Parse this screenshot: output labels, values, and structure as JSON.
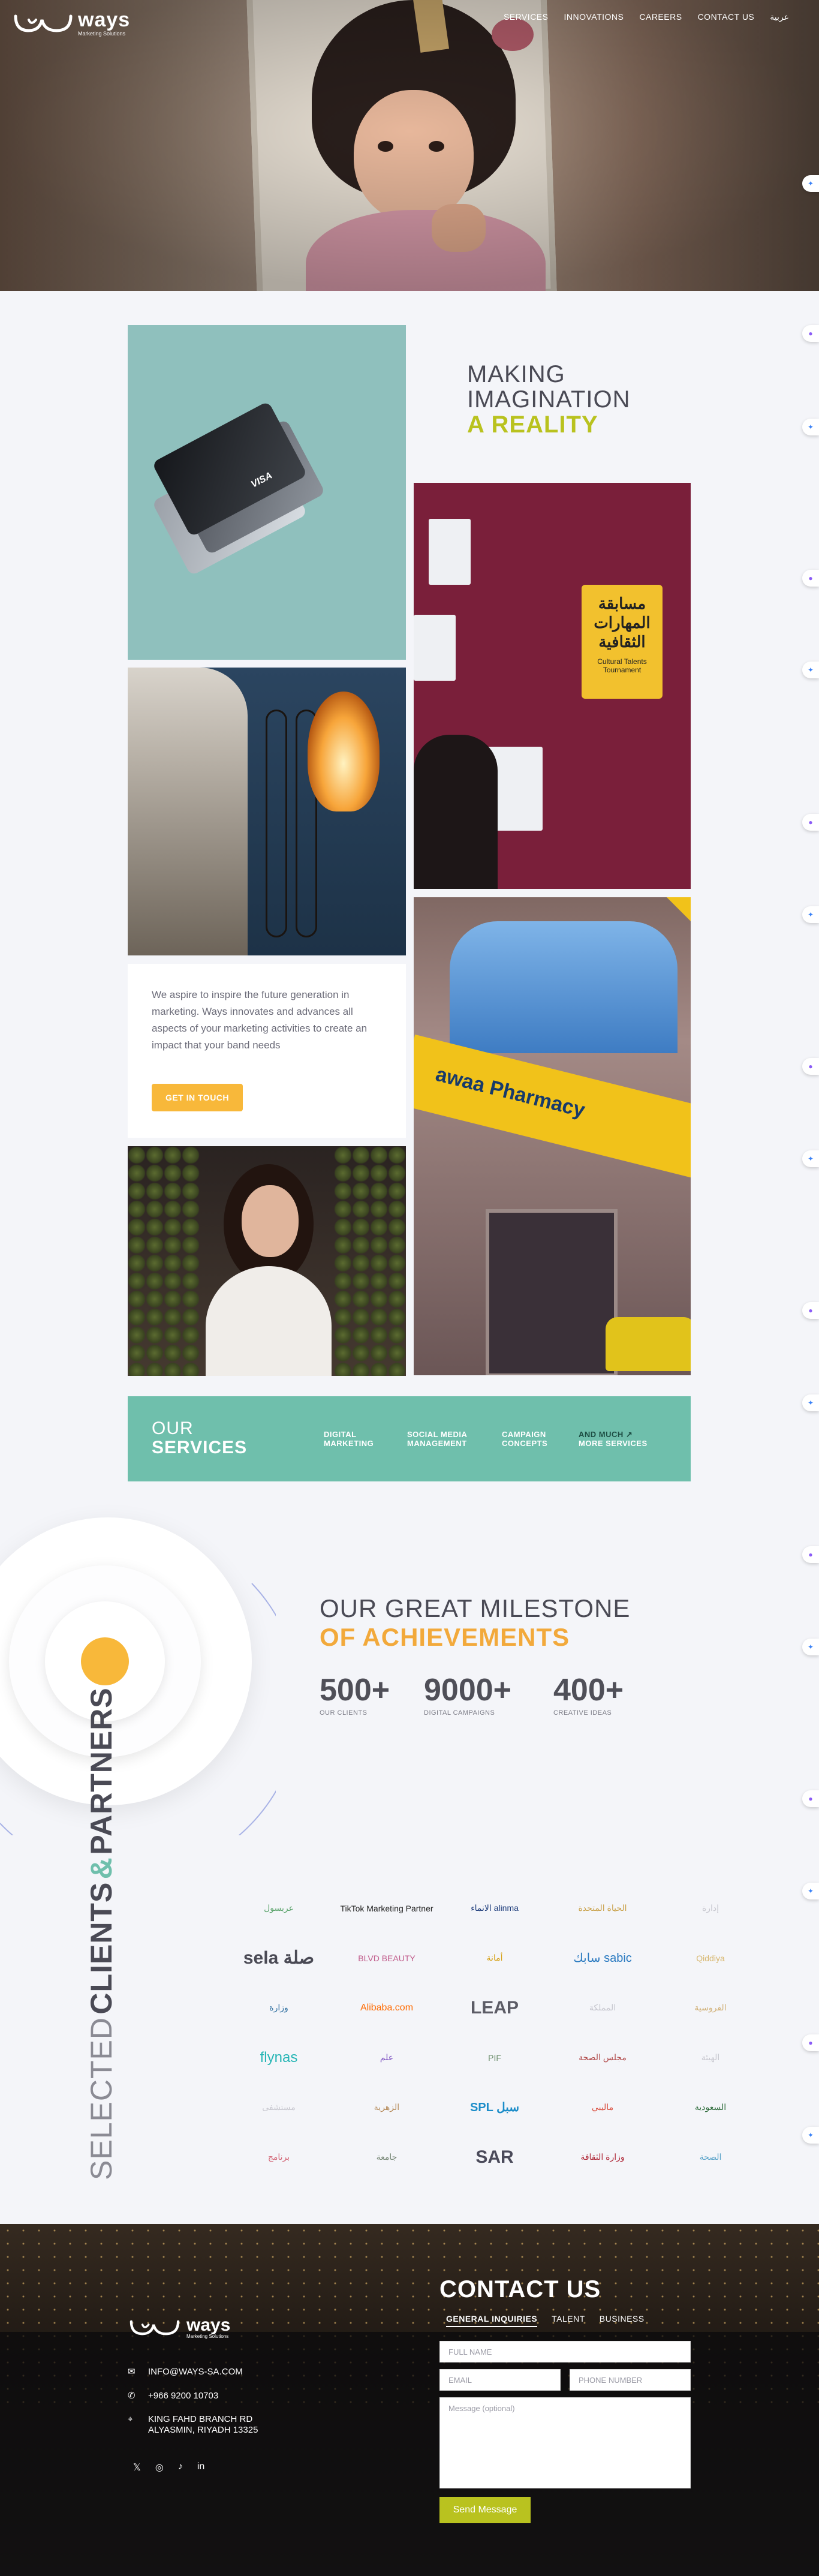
{
  "nav": {
    "brand": "ways",
    "brand_sub": "Marketing Solutions",
    "menu": [
      "SERVICES",
      "INNOVATIONS",
      "CAREERS",
      "CONTACT US",
      "عربية"
    ]
  },
  "headline": {
    "line1": "MAKING",
    "line2": "IMAGINATION",
    "line3": "A REALITY"
  },
  "poster": {
    "arabic": "مسابقة المهارات الثقافية",
    "english": "Cultural Talents Tournament"
  },
  "pharmacy_sign": "awaa Pharmacy",
  "intro": {
    "text": "We aspire to inspire the future generation in marketing. Ways innovates and advances all aspects of your marketing activities to create an impact that your band needs",
    "cta": "GET IN TOUCH"
  },
  "services": {
    "our": "OUR",
    "title": "SERVICES",
    "items": [
      {
        "l1": "DIGITAL",
        "l2": "MARKETING"
      },
      {
        "l1": "SOCIAL MEDIA",
        "l2": "MANAGEMENT"
      },
      {
        "l1": "CAMPAIGN",
        "l2": "CONCEPTS"
      },
      {
        "l1": "AND MUCH ↗",
        "l2": "MORE SERVICES"
      }
    ]
  },
  "milestone": {
    "title1": "OUR GREAT MILESTONE",
    "title2": "OF ACHIEVEMENTS",
    "stats": [
      {
        "value": "500+",
        "label": "OUR CLIENTS"
      },
      {
        "value": "9000+",
        "label": "DIGITAL CAMPAIGNS"
      },
      {
        "value": "400+",
        "label": "CREATIVE IDEAS"
      }
    ]
  },
  "clients": {
    "word1": "SELECTED",
    "word2": "CLIENTS",
    "amp": "&",
    "word3": "PARTNERS",
    "logos": [
      "عربسول",
      "TikTok Marketing Partner",
      "الانماء alinma",
      "الحياة المتحدة",
      "إدارة",
      "sela صلة",
      "BLVD BEAUTY",
      "أمانة",
      "سابك sabic",
      "Qiddiya",
      "وزارة",
      "Alibaba.com",
      "LEAP",
      "المملكة",
      "الفروسية",
      "flynas",
      "علم",
      "PIF",
      "مجلس الصحة",
      "الهيئة",
      "مستشفى",
      "الزهرية",
      "SPL سبل",
      "ماليبي",
      "السعودية",
      "برنامج",
      "جامعة",
      "SAR",
      "وزارة الثقافة",
      "الصحة"
    ]
  },
  "footer": {
    "brand": "ways",
    "brand_sub": "Marketing Solutions",
    "email": "INFO@WAYS-SA.COM",
    "phone": "+966 9200 10703",
    "address1": "KING FAHD BRANCH RD",
    "address2": "ALYASMIN, RIYADH 13325",
    "contact_title": "CONTACT US",
    "tabs": [
      "GENERAL INQUIRIES",
      "TALENT",
      "BUSINESS"
    ],
    "full_name_ph": "FULL NAME",
    "email_ph": "EMAIL",
    "phone_ph": "PHONE NUMBER",
    "message_ph": "Message (optional)",
    "send": "Send Message"
  },
  "colors": {
    "accent_lime": "#b9c21f",
    "accent_orange": "#f8b83a",
    "teal": "#6fbfac",
    "text_dark": "#4a4a55"
  }
}
